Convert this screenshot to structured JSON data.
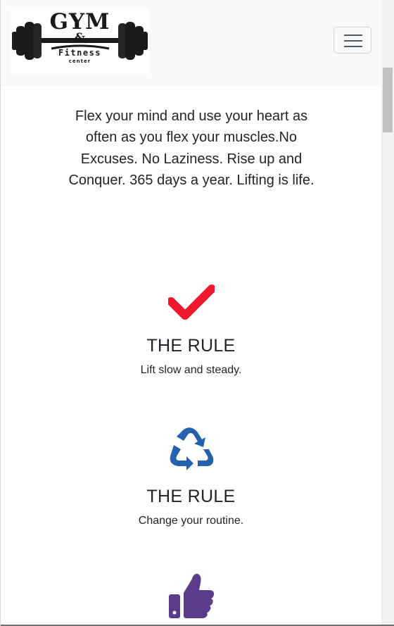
{
  "navbar": {
    "logo": {
      "line1": "GYM",
      "line2": "&",
      "line3": "Fitness",
      "line4": "center"
    },
    "toggle_icon": "hamburger-icon"
  },
  "intro": {
    "text": "Flex your mind and use your heart as often as you flex your muscles.No Excuses. No Laziness. Rise up and Conquer. 365 days a year. Lifting is life."
  },
  "features": [
    {
      "icon": "checkmark-icon",
      "color": "#f0192b",
      "title": "THE RULE",
      "text": "Lift slow and steady."
    },
    {
      "icon": "recycle-icon",
      "color": "#2462ad",
      "title": "THE RULE",
      "text": "Change your routine."
    },
    {
      "icon": "thumbs-up-icon",
      "color": "#5b3c8c",
      "title": "",
      "text": ""
    }
  ]
}
